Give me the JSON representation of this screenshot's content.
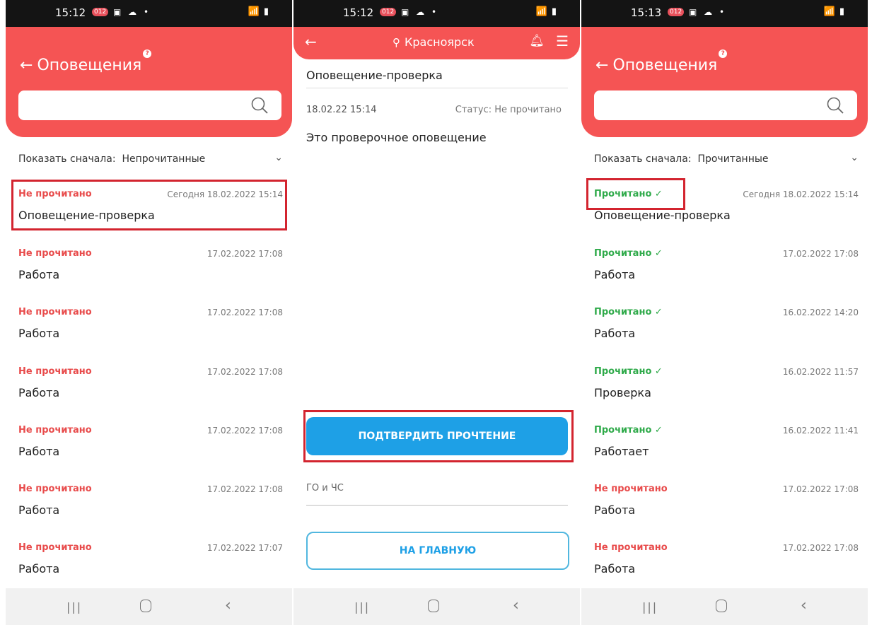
{
  "screen1": {
    "status_time": "15:12",
    "status_left_icons": "▣ ☁ •",
    "status_right": "📶 ▮",
    "title": "Оповещения",
    "search_placeholder": "",
    "sort_label": "Показать сначала:",
    "sort_value": "Непрочитанные",
    "items": [
      {
        "status": "Не прочитано",
        "date": "Сегодня 18.02.2022 15:14",
        "name": "Оповещение-проверка"
      },
      {
        "status": "Не прочитано",
        "date": "17.02.2022 17:08",
        "name": "Работа"
      },
      {
        "status": "Не прочитано",
        "date": "17.02.2022 17:08",
        "name": "Работа"
      },
      {
        "status": "Не прочитано",
        "date": "17.02.2022 17:08",
        "name": "Работа"
      },
      {
        "status": "Не прочитано",
        "date": "17.02.2022 17:08",
        "name": "Работа"
      },
      {
        "status": "Не прочитано",
        "date": "17.02.2022 17:08",
        "name": "Работа"
      },
      {
        "status": "Не прочитано",
        "date": "17.02.2022 17:07",
        "name": "Работа"
      }
    ]
  },
  "screen2": {
    "status_time": "15:12",
    "status_left_icons": "▣ ☁ •",
    "status_right": "📶 ▮",
    "city": "Красноярск",
    "title": "Оповещение-проверка",
    "date": "18.02.22  15:14",
    "status": "Статус: Не прочитано",
    "body": "Это проверочное оповещение",
    "confirm_button": "ПОДТВЕРДИТЬ ПРОЧТЕНИЕ",
    "category": "ГО и ЧС",
    "home_button": "НА ГЛАВНУЮ"
  },
  "screen3": {
    "status_time": "15:13",
    "status_left_icons": "▣ ☁ •",
    "status_right": "📶 ▮",
    "title": "Оповещения",
    "search_placeholder": "",
    "sort_label": "Показать сначала:",
    "sort_value": "Прочитанные",
    "items": [
      {
        "status": "Прочитано ✓",
        "date": "Сегодня 18.02.2022 15:14",
        "name": "Оповещение-проверка"
      },
      {
        "status": "Прочитано ✓",
        "date": "17.02.2022 17:08",
        "name": "Работа"
      },
      {
        "status": "Прочитано ✓",
        "date": "16.02.2022 14:20",
        "name": "Работа"
      },
      {
        "status": "Прочитано ✓",
        "date": "16.02.2022 11:57",
        "name": "Проверка"
      },
      {
        "status": "Прочитано ✓",
        "date": "16.02.2022 11:41",
        "name": "Работает"
      },
      {
        "status": "Не прочитано",
        "date": "17.02.2022 17:08",
        "name": "Работа"
      },
      {
        "status": "Не прочитано",
        "date": "17.02.2022 17:08",
        "name": "Работа"
      }
    ]
  },
  "colors": {
    "header_red": "#f55454",
    "unread_red": "#e84b4b",
    "read_green": "#2faa4a",
    "button_blue": "#1ea0e6",
    "highlight": "#d3242f"
  },
  "icons": {
    "back": "arrow-left-icon",
    "search": "magnifier-icon",
    "pin": "location-pin-icon",
    "bell": "bell-icon",
    "menu": "hamburger-menu-icon",
    "chevron": "chevron-down-icon",
    "help": "question-badge-icon"
  }
}
